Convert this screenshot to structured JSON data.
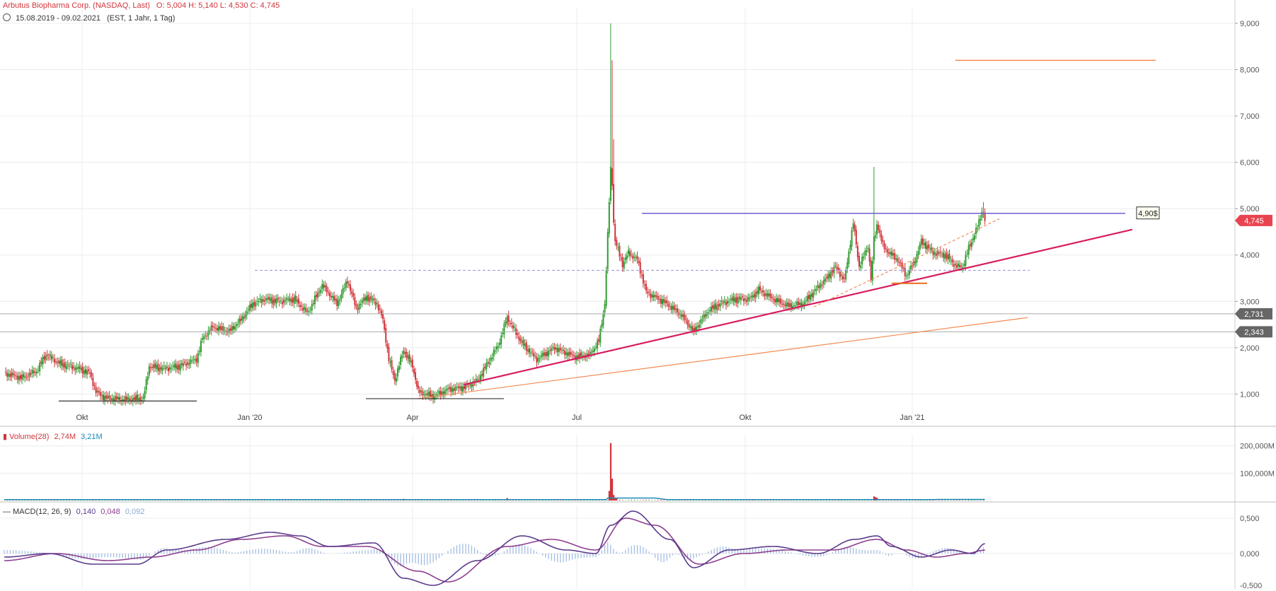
{
  "header": {
    "title": "Arbutus Biopharma Corp. (NASDAQ, Last)",
    "ohlc": "O: 5,004   H: 5,140   L: 4,530   C: 4,745",
    "range": "15.08.2019 - 09.02.2021",
    "range_info": "(EST, 1 Jahr, 1 Tag)"
  },
  "colors": {
    "up": "#2e9b2e",
    "down": "#d0353b",
    "grid": "#ececec",
    "resistance": "#6b5fd0",
    "trend_main": "#d81b60",
    "trend_secondary": "#f28a52",
    "support_flat": "#333333",
    "macd_line": "#5a3b8c",
    "signal_line": "#8e3e8e",
    "histogram": "#9bb8e0"
  },
  "chart_data": {
    "type": "candlestick",
    "price_axis": {
      "ticks": [
        "9,000",
        "8,000",
        "7,000",
        "6,000",
        "5,000",
        "4,000",
        "3,000",
        "2,000",
        "1,000"
      ],
      "ylim": [
        0.35,
        9.35
      ]
    },
    "x_axis": {
      "ticks": [
        "Okt",
        "Jan '20",
        "Apr",
        "Jul",
        "Okt",
        "Jan '21"
      ]
    },
    "price_markers": [
      {
        "label": "4,745",
        "value": 4.745,
        "color": "#e8444f"
      },
      {
        "label": "2,731",
        "value": 2.731,
        "color": "#666666"
      },
      {
        "label": "2,343",
        "value": 2.343,
        "color": "#666666"
      }
    ],
    "annotation": {
      "label": "4,90$",
      "value": 4.9
    },
    "keypoints": [
      [
        0,
        1.45
      ],
      [
        12,
        1.35
      ],
      [
        22,
        1.5
      ],
      [
        28,
        1.85
      ],
      [
        38,
        1.65
      ],
      [
        50,
        1.55
      ],
      [
        58,
        1.45
      ],
      [
        62,
        1.05
      ],
      [
        68,
        0.92
      ],
      [
        80,
        0.88
      ],
      [
        90,
        0.9
      ],
      [
        94,
        0.9
      ],
      [
        98,
        1.6
      ],
      [
        108,
        1.55
      ],
      [
        118,
        1.6
      ],
      [
        130,
        1.75
      ],
      [
        134,
        2.2
      ],
      [
        141,
        2.45
      ],
      [
        152,
        2.35
      ],
      [
        160,
        2.6
      ],
      [
        168,
        2.95
      ],
      [
        176,
        3.05
      ],
      [
        186,
        3.0
      ],
      [
        196,
        3.05
      ],
      [
        205,
        2.75
      ],
      [
        215,
        3.35
      ],
      [
        225,
        2.95
      ],
      [
        232,
        3.45
      ],
      [
        238,
        2.85
      ],
      [
        245,
        3.1
      ],
      [
        252,
        2.95
      ],
      [
        256,
        2.6
      ],
      [
        260,
        1.75
      ],
      [
        264,
        1.3
      ],
      [
        270,
        1.95
      ],
      [
        276,
        1.6
      ],
      [
        280,
        1.05
      ],
      [
        290,
        0.95
      ],
      [
        300,
        1.1
      ],
      [
        312,
        1.15
      ],
      [
        320,
        1.3
      ],
      [
        334,
        2.05
      ],
      [
        340,
        2.65
      ],
      [
        350,
        2.1
      ],
      [
        360,
        1.75
      ],
      [
        372,
        2.0
      ],
      [
        386,
        1.8
      ],
      [
        396,
        1.85
      ],
      [
        402,
        2.15
      ],
      [
        406,
        2.95
      ],
      [
        410,
        5.9
      ],
      [
        413,
        4.3
      ],
      [
        418,
        3.8
      ],
      [
        422,
        4.05
      ],
      [
        428,
        3.9
      ],
      [
        434,
        3.2
      ],
      [
        448,
        2.95
      ],
      [
        458,
        2.7
      ],
      [
        466,
        2.35
      ],
      [
        476,
        2.8
      ],
      [
        484,
        2.95
      ],
      [
        494,
        3.05
      ],
      [
        504,
        3.05
      ],
      [
        510,
        3.25
      ],
      [
        520,
        3.05
      ],
      [
        530,
        2.9
      ],
      [
        540,
        2.95
      ],
      [
        550,
        3.3
      ],
      [
        556,
        3.5
      ],
      [
        562,
        3.75
      ],
      [
        568,
        3.45
      ],
      [
        574,
        4.7
      ],
      [
        578,
        3.75
      ],
      [
        584,
        4.2
      ],
      [
        586,
        3.5
      ],
      [
        590,
        4.7
      ],
      [
        594,
        4.2
      ],
      [
        598,
        4.05
      ],
      [
        604,
        3.9
      ],
      [
        610,
        3.55
      ],
      [
        616,
        3.9
      ],
      [
        620,
        4.3
      ],
      [
        628,
        4.05
      ],
      [
        636,
        4.0
      ],
      [
        644,
        3.75
      ],
      [
        648,
        3.75
      ],
      [
        652,
        4.15
      ],
      [
        658,
        4.6
      ],
      [
        661,
        4.95
      ],
      [
        663,
        4.745
      ]
    ],
    "spikes": [
      {
        "index": 410,
        "high": 9.0,
        "close": 5.9
      },
      {
        "index": 411,
        "high": 8.2,
        "close": 5.5
      },
      {
        "index": 412,
        "high": 6.5,
        "close": 4.7
      },
      {
        "index": 588,
        "high": 5.9,
        "close": 4.4
      },
      {
        "index": 662,
        "high": 5.14,
        "close": 4.9
      }
    ],
    "volume": {
      "label": "Volume(28)",
      "value1": "2,74M",
      "value2": "3,21M",
      "ticks": [
        "200,000M",
        "100,000M"
      ],
      "ymax": 220,
      "spikes": [
        [
          410,
          210
        ],
        [
          409,
          35
        ],
        [
          411,
          80
        ],
        [
          412,
          20
        ],
        [
          413,
          10
        ],
        [
          414,
          8
        ],
        [
          588,
          15
        ],
        [
          589,
          12
        ],
        [
          590,
          10
        ],
        [
          60,
          5
        ],
        [
          270,
          6
        ],
        [
          340,
          9
        ],
        [
          506,
          5
        ]
      ]
    },
    "macd": {
      "label": "MACD(12, 26, 9)",
      "macd_value": "0,140",
      "signal_value": "0,048",
      "hist_value": "0,092",
      "ticks": [
        "0,500",
        "0,000",
        "-0,500"
      ],
      "ylim": [
        -0.5,
        0.68
      ],
      "macd_keys": [
        [
          0,
          -0.05
        ],
        [
          30,
          0.0
        ],
        [
          60,
          -0.15
        ],
        [
          90,
          -0.15
        ],
        [
          110,
          0.05
        ],
        [
          150,
          0.2
        ],
        [
          180,
          0.3
        ],
        [
          200,
          0.25
        ],
        [
          220,
          0.1
        ],
        [
          250,
          0.15
        ],
        [
          270,
          -0.35
        ],
        [
          290,
          -0.45
        ],
        [
          320,
          -0.1
        ],
        [
          350,
          0.25
        ],
        [
          380,
          0.05
        ],
        [
          400,
          0.0
        ],
        [
          410,
          0.4
        ],
        [
          425,
          0.6
        ],
        [
          450,
          0.2
        ],
        [
          466,
          -0.2
        ],
        [
          490,
          0.05
        ],
        [
          520,
          0.1
        ],
        [
          550,
          0.0
        ],
        [
          575,
          0.2
        ],
        [
          590,
          0.25
        ],
        [
          600,
          0.1
        ],
        [
          620,
          -0.05
        ],
        [
          640,
          0.05
        ],
        [
          655,
          0.0
        ],
        [
          663,
          0.14
        ]
      ],
      "signal_keys": [
        [
          0,
          -0.1
        ],
        [
          35,
          0.0
        ],
        [
          70,
          -0.1
        ],
        [
          100,
          -0.05
        ],
        [
          130,
          0.05
        ],
        [
          160,
          0.2
        ],
        [
          190,
          0.25
        ],
        [
          215,
          0.1
        ],
        [
          245,
          0.1
        ],
        [
          280,
          -0.25
        ],
        [
          300,
          -0.4
        ],
        [
          340,
          0.1
        ],
        [
          370,
          0.2
        ],
        [
          400,
          0.05
        ],
        [
          420,
          0.5
        ],
        [
          440,
          0.4
        ],
        [
          470,
          -0.15
        ],
        [
          500,
          0.0
        ],
        [
          530,
          0.05
        ],
        [
          560,
          0.05
        ],
        [
          590,
          0.2
        ],
        [
          610,
          0.05
        ],
        [
          630,
          -0.05
        ],
        [
          650,
          0.0
        ],
        [
          663,
          0.048
        ]
      ]
    }
  }
}
